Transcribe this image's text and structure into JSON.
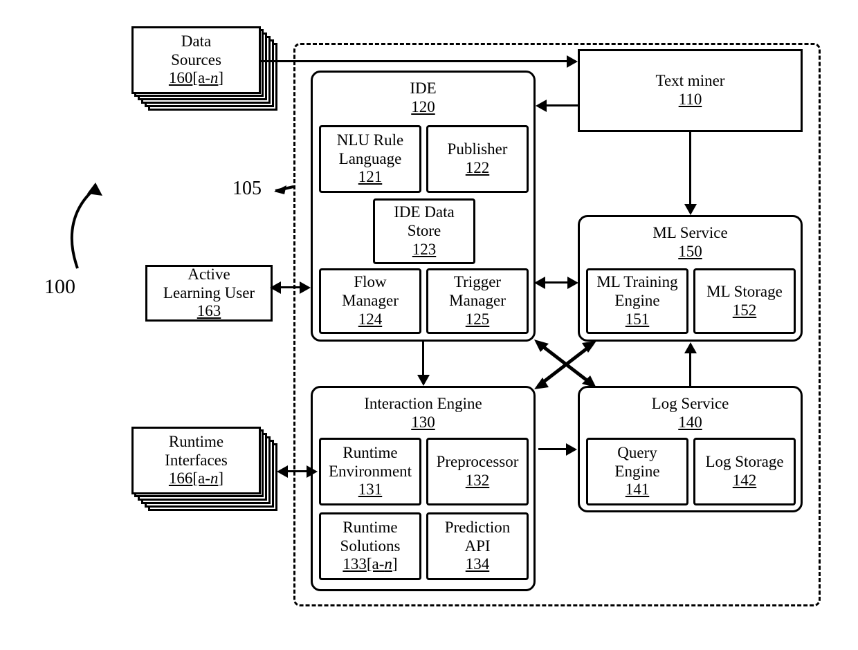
{
  "figure": {
    "system_label": "100",
    "boundary_label": "105"
  },
  "external": {
    "data_sources": {
      "line1": "Data",
      "line2": "Sources",
      "ref": "160",
      "suffix": "[a-n]"
    },
    "active_learning_user": {
      "line1": "Active",
      "line2": "Learning User",
      "ref": "163"
    },
    "runtime_interfaces": {
      "line1": "Runtime",
      "line2": "Interfaces",
      "ref": "166",
      "suffix": "[a-n]"
    }
  },
  "nodes": {
    "text_miner": {
      "title": "Text miner",
      "ref": "110"
    },
    "ide": {
      "title": "IDE",
      "ref": "120",
      "children": [
        {
          "title": "NLU Rule Language",
          "ref": "121"
        },
        {
          "title": "Publisher",
          "ref": "122"
        },
        {
          "title": "IDE Data Store",
          "ref": "123"
        },
        {
          "title": "Flow Manager",
          "ref": "124"
        },
        {
          "title": "Trigger Manager",
          "ref": "125"
        }
      ]
    },
    "interaction_engine": {
      "title": "Interaction Engine",
      "ref": "130",
      "children": [
        {
          "title": "Runtime Environment",
          "ref": "131"
        },
        {
          "title": "Preprocessor",
          "ref": "132"
        },
        {
          "title": "Runtime Solutions",
          "ref": "133",
          "suffix": "[a-n]"
        },
        {
          "title": "Prediction API",
          "ref": "134"
        }
      ]
    },
    "log_service": {
      "title": "Log Service",
      "ref": "140",
      "children": [
        {
          "title": "Query Engine",
          "ref": "141"
        },
        {
          "title": "Log Storage",
          "ref": "142"
        }
      ]
    },
    "ml_service": {
      "title": "ML Service",
      "ref": "150",
      "children": [
        {
          "title": "ML Training Engine",
          "ref": "151"
        },
        {
          "title": "ML Storage",
          "ref": "152"
        }
      ]
    }
  },
  "connections": [
    {
      "name": "data-sources-to-text-miner",
      "from": "data_sources",
      "to": "text_miner",
      "direction": "one-way"
    },
    {
      "name": "text-miner-to-ide",
      "from": "text_miner",
      "to": "ide",
      "direction": "one-way"
    },
    {
      "name": "text-miner-to-ml-service",
      "from": "text_miner",
      "to": "ml_service",
      "direction": "one-way"
    },
    {
      "name": "ide-to-ml-service",
      "from": "ide",
      "to": "ml_service",
      "direction": "two-way"
    },
    {
      "name": "ide-to-interaction-engine",
      "from": "ide",
      "to": "interaction_engine",
      "direction": "one-way"
    },
    {
      "name": "ide-to-log-service",
      "from": "ide",
      "to": "log_service",
      "direction": "two-way"
    },
    {
      "name": "interaction-engine-to-ml-service",
      "from": "interaction_engine",
      "to": "ml_service",
      "direction": "two-way"
    },
    {
      "name": "interaction-engine-to-log-service",
      "from": "interaction_engine",
      "to": "log_service",
      "direction": "one-way"
    },
    {
      "name": "log-service-to-ml-service",
      "from": "log_service",
      "to": "ml_service",
      "direction": "one-way"
    },
    {
      "name": "active-learning-user-to-ide",
      "from": "active_learning_user",
      "to": "ide",
      "direction": "two-way"
    },
    {
      "name": "runtime-interfaces-to-interaction-engine",
      "from": "runtime_interfaces",
      "to": "interaction_engine",
      "direction": "two-way"
    }
  ]
}
